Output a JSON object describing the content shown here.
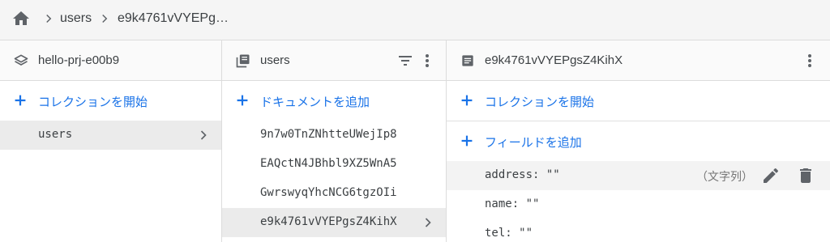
{
  "breadcrumb": {
    "home_icon": "home-icon",
    "items": [
      "users",
      "e9k4761vVYEPg…"
    ]
  },
  "root_panel": {
    "project": "hello-prj-e00b9",
    "add_collection_label": "コレクションを開始",
    "collections": [
      "users"
    ]
  },
  "collection_panel": {
    "title": "users",
    "add_document_label": "ドキュメントを追加",
    "documents": [
      "9n7w0TnZNhtteUWejIp8",
      "EAQctN4JBhbl9XZ5WnA5",
      "GwrswyqYhcNCG6tgzOIi",
      "e9k4761vVYEPgsZ4KihX"
    ]
  },
  "document_panel": {
    "title": "e9k4761vVYEPgsZ4KihX",
    "add_collection_label": "コレクションを開始",
    "add_field_label": "フィールドを追加",
    "fields": [
      {
        "text": "address: \"\"",
        "type": "（文字列）"
      },
      {
        "text": "name: \"\""
      },
      {
        "text": "tel: \"\""
      }
    ]
  },
  "colors": {
    "accent": "#1a73e8",
    "icon": "#5f6368"
  }
}
